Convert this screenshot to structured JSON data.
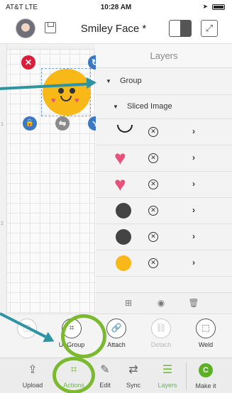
{
  "status_bar": {
    "carrier": "AT&T  LTE",
    "time": "10:28 AM"
  },
  "header": {
    "title": "Smiley Face *"
  },
  "canvas": {
    "ruler_marks": [
      "1",
      "2"
    ]
  },
  "layers_panel": {
    "title": "Layers",
    "group_label": "Group",
    "sliced_label": "Sliced Image",
    "layers": [
      {
        "thumb": "mouth",
        "color": "#222222"
      },
      {
        "thumb": "heart",
        "color": "#e8517a"
      },
      {
        "thumb": "heart",
        "color": "#e8517a"
      },
      {
        "thumb": "circle",
        "color": "#444444"
      },
      {
        "thumb": "circle",
        "color": "#444444"
      },
      {
        "thumb": "circle",
        "color": "#f8b817"
      }
    ]
  },
  "actions": [
    {
      "label": "",
      "icon": "slice-icon",
      "enabled": false
    },
    {
      "label": "UnGroup",
      "icon": "ungroup-icon",
      "enabled": true
    },
    {
      "label": "Attach",
      "icon": "attach-icon",
      "enabled": true
    },
    {
      "label": "Detach",
      "icon": "detach-icon",
      "enabled": false
    },
    {
      "label": "Weld",
      "icon": "weld-icon",
      "enabled": true
    }
  ],
  "tabs": [
    {
      "label": "Upload",
      "icon": "upload-icon",
      "active": false
    },
    {
      "label": "Actions",
      "icon": "actions-icon",
      "active": true
    },
    {
      "label": "Edit",
      "icon": "edit-icon",
      "active": false
    },
    {
      "label": "Sync",
      "icon": "sync-icon",
      "active": false
    },
    {
      "label": "Layers",
      "icon": "layers-icon",
      "active": true
    },
    {
      "label": "Make it",
      "icon": "make-it-icon",
      "active": false
    }
  ],
  "colors": {
    "accent": "#6ab832",
    "annotation_ring": "#7bb92f",
    "annotation_arrow": "#2d94a2"
  }
}
